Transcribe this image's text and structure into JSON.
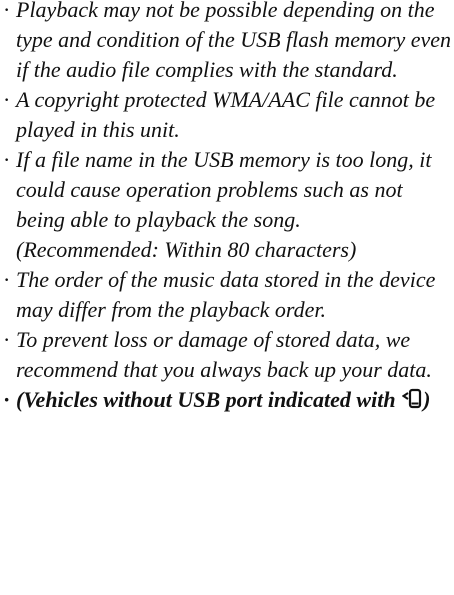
{
  "notes": [
    {
      "bullet": "·",
      "text": "Playback may not be possible depending on the type and condition of the USB flash memory even if the audio file complies with the standard."
    },
    {
      "bullet": "·",
      "text": "A copyright protected WMA/AAC file cannot be played in this unit."
    },
    {
      "bullet": "·",
      "text": "If a file name in the USB memory is too long, it could cause operation problems such as not being able to playback the song.",
      "subtext": "(Recommended: Within 80 characters)"
    },
    {
      "bullet": "·",
      "text": "The order of the music data stored in the device may differ from the playback order."
    },
    {
      "bullet": "·",
      "text": "To prevent loss or damage of stored data, we recommend that you always back up your data."
    },
    {
      "bullet": "·",
      "text_before_icon": "(Vehicles without USB port indicated with ",
      "icon": "phone-connector-icon",
      "text_after_icon": ")"
    }
  ]
}
